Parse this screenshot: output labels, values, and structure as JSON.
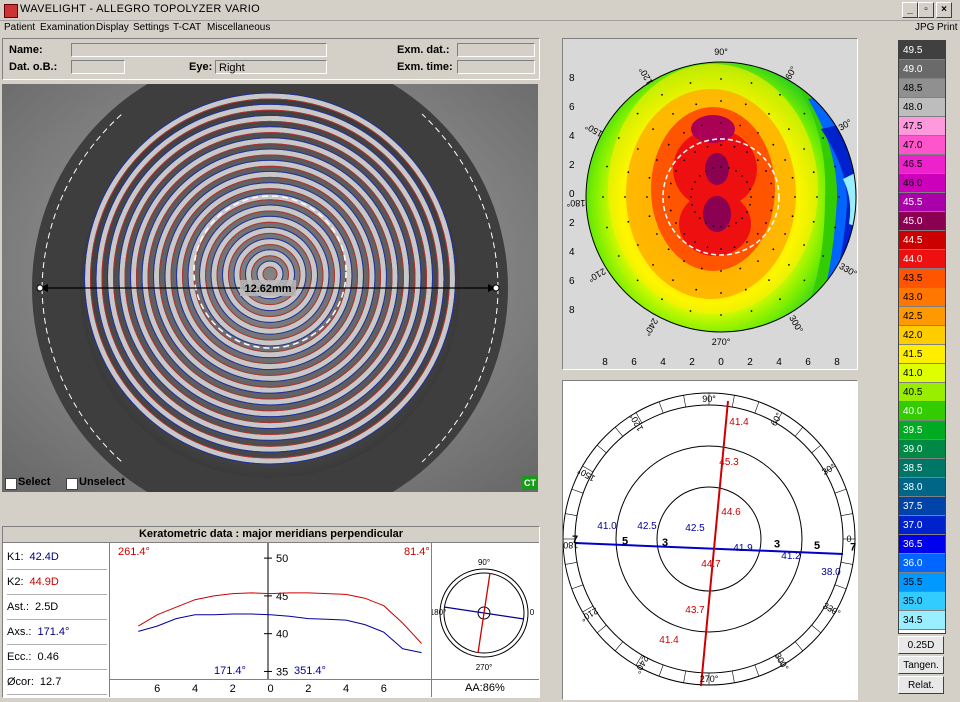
{
  "window": {
    "title": "WAVELIGHT - ALLEGRO TOPOLYZER VARIO"
  },
  "menu": {
    "items": [
      "Patient",
      "Examination",
      "Display",
      "Settings",
      "T-CAT",
      "Miscellaneous"
    ],
    "right_items": [
      "JPG",
      "Print"
    ]
  },
  "patient": {
    "name_label": "Name:",
    "name_value": "",
    "dob_label": "Dat. o.B.:",
    "dob_value": "",
    "eye_label": "Eye:",
    "eye_value": "Right",
    "exam_date_label": "Exm. dat.:",
    "exam_date_value": "",
    "exam_time_label": "Exm. time:",
    "exam_time_value": ""
  },
  "eye_image": {
    "diameter_label": "12.62mm",
    "select_label": "Select",
    "unselect_label": "Unselect",
    "ct_badge": "CT"
  },
  "topo_map": {
    "angle_labels": [
      "90°",
      "60°",
      "30°",
      "0",
      "330°",
      "300°",
      "270°",
      "240°",
      "210°",
      "180°",
      "150°",
      "120°"
    ],
    "y_ticks": [
      "8",
      "6",
      "4",
      "2",
      "0",
      "2",
      "4",
      "6",
      "8"
    ],
    "x_ticks": [
      "8",
      "6",
      "4",
      "2",
      "0",
      "2",
      "4",
      "6",
      "8"
    ]
  },
  "meridian_map": {
    "angle_labels": [
      "90°",
      "60°",
      "30°",
      "0",
      "330°",
      "300°",
      "270°",
      "240°",
      "210°",
      "180°",
      "150°",
      "120°"
    ],
    "ring_labels": [
      "7",
      "5",
      "3",
      "3",
      "5",
      "7"
    ],
    "red_values": [
      "41.4",
      "45.3",
      "44.6",
      "44.7",
      "43.7",
      "41.4"
    ],
    "blue_values": [
      "41.0",
      "42.5",
      "42.5",
      "41.9",
      "41.2",
      "38.0"
    ]
  },
  "scale": {
    "values": [
      "49.5",
      "49.0",
      "48.5",
      "48.0",
      "47.5",
      "47.0",
      "46.5",
      "46.0",
      "45.5",
      "45.0",
      "44.5",
      "44.0",
      "43.5",
      "43.0",
      "42.5",
      "42.0",
      "41.5",
      "41.0",
      "40.5",
      "40.0",
      "39.5",
      "39.0",
      "38.5",
      "38.0",
      "37.5",
      "37.0",
      "36.5",
      "36.0",
      "35.5",
      "35.0",
      "34.5"
    ],
    "colors": [
      "#404040",
      "#6a6a6a",
      "#909090",
      "#bdbdbd",
      "#ff99dd",
      "#ff55cc",
      "#ee22cc",
      "#cc00bb",
      "#aa00aa",
      "#8b0050",
      "#cc0000",
      "#ee1010",
      "#ff5500",
      "#ff7700",
      "#ff9900",
      "#ffcc00",
      "#ffee00",
      "#ddff00",
      "#99ee00",
      "#33cc00",
      "#00aa22",
      "#008844",
      "#007766",
      "#006688",
      "#0044aa",
      "#0022cc",
      "#0000ee",
      "#0066ff",
      "#0099ff",
      "#33ccff",
      "#99eeff"
    ],
    "step_button": "0.25D",
    "mode_button": "Tangen.",
    "ref_button": "Relat."
  },
  "kerato": {
    "title": "Keratometric data : major meridians perpendicular",
    "rows": [
      {
        "label": "K1:",
        "value": "42.4D",
        "color": "#000080"
      },
      {
        "label": "K2:",
        "value": "44.9D",
        "color": "#cc0000"
      },
      {
        "label": "Ast.:",
        "value": "2.5D",
        "color": "#000000"
      },
      {
        "label": "Axs.:",
        "value": "171.4°",
        "color": "#000080"
      },
      {
        "label": "Ecc.:",
        "value": "0.46",
        "color": "#000000"
      },
      {
        "label": "Øcor:",
        "value": "12.7",
        "color": "#000000"
      }
    ],
    "left_angle_red": "261.4°",
    "right_angle_red": "81.4°",
    "left_angle_blue": "171.4°",
    "right_angle_blue": "351.4°",
    "y_ticks": [
      "50",
      "45",
      "40",
      "35"
    ],
    "x_ticks": [
      "6",
      "4",
      "2",
      "0",
      "2",
      "4",
      "6"
    ],
    "mini_angle_labels": [
      "90°",
      "0",
      "270°",
      "180°"
    ],
    "aa_label": "AA:86%"
  },
  "chart_data": {
    "type": "line",
    "title": "Keratometric data : major meridians perpendicular",
    "ylim": [
      34,
      52
    ],
    "x": [
      -7,
      -6,
      -5,
      -4,
      -3,
      -2,
      -1,
      0,
      1,
      2,
      3,
      4,
      5,
      6,
      7,
      8
    ],
    "series": [
      {
        "values": [
          41.0,
          42.5,
          43.5,
          44.5,
          45.0,
          45.3,
          45.4,
          45.3,
          45.4,
          45.4,
          45.3,
          45.2,
          44.7,
          43.7,
          41.4,
          38.7
        ]
      },
      {
        "values": [
          40.3,
          41.0,
          42.0,
          42.5,
          42.5,
          42.6,
          42.6,
          42.5,
          42.3,
          42.0,
          41.9,
          41.8,
          41.2,
          40.2,
          38.0,
          37.5
        ]
      }
    ]
  }
}
